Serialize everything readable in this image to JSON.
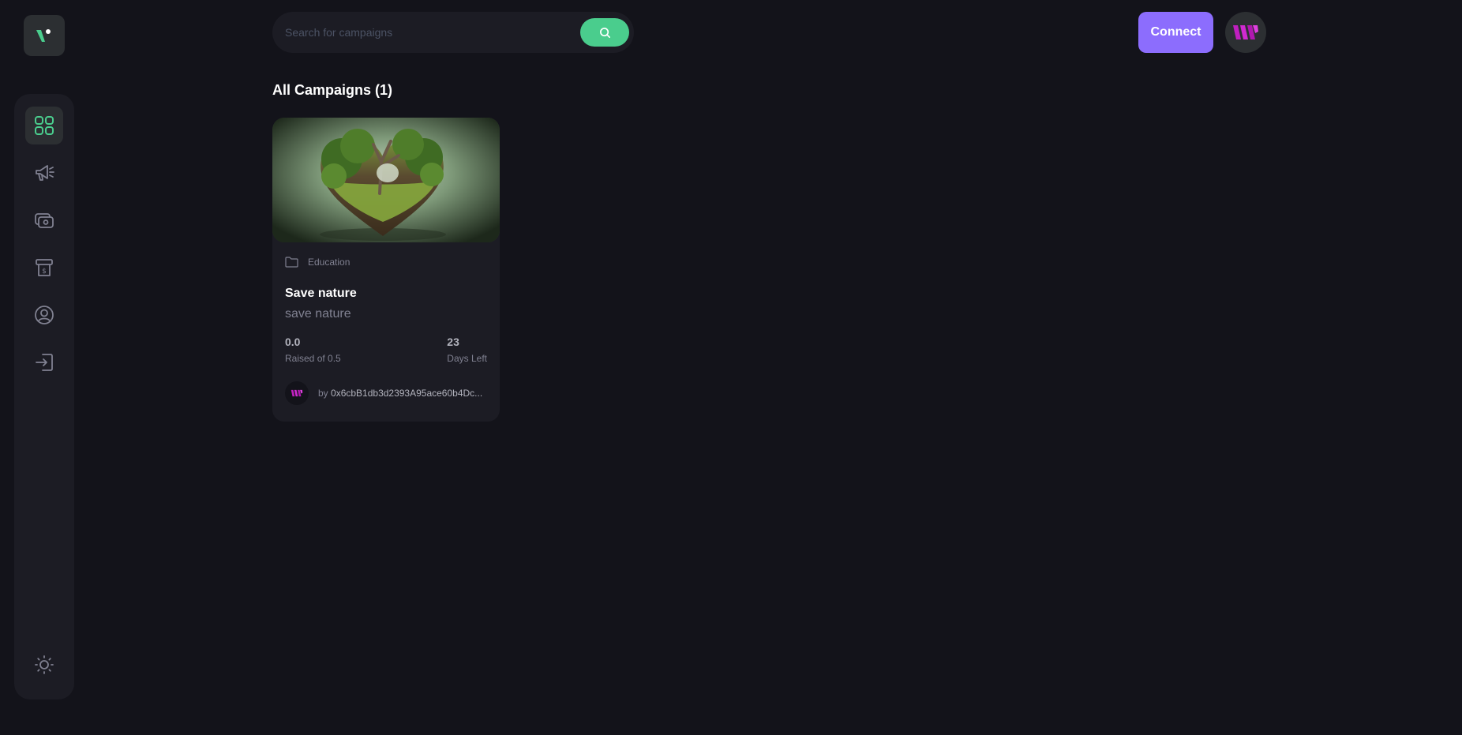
{
  "app": {
    "logo_icon": "brand-v-logo-icon"
  },
  "sidebar": {
    "items": [
      {
        "name": "dashboard",
        "icon": "dashboard-grid-icon",
        "active": true
      },
      {
        "name": "campaign",
        "icon": "megaphone-icon",
        "active": false
      },
      {
        "name": "payment",
        "icon": "payment-icon",
        "active": false
      },
      {
        "name": "withdraw",
        "icon": "withdraw-icon",
        "active": false
      },
      {
        "name": "profile",
        "icon": "user-profile-icon",
        "active": false
      },
      {
        "name": "logout",
        "icon": "logout-icon",
        "active": false
      }
    ],
    "theme_icon": "sun-icon"
  },
  "header": {
    "search": {
      "placeholder": "Search for campaigns",
      "value": ""
    },
    "connect_label": "Connect",
    "profile_icon": "user-logo-icon"
  },
  "main": {
    "title": "All Campaigns (1)",
    "campaigns": [
      {
        "image": "heart-tree-image",
        "category": "Education",
        "title": "Save nature",
        "description": "save nature",
        "amount_collected": "0.0",
        "raised_label": "Raised of 0.5",
        "days_left": "23",
        "days_left_label": "Days Left",
        "owner_prefix": "by ",
        "owner": "0x6cbB1db3d2393A95ace60b4Dc..."
      }
    ]
  },
  "colors": {
    "background": "#13131a",
    "panel": "#1c1c24",
    "active_item": "#2c2f32",
    "accent_green": "#4acd8d",
    "connect_purple": "#8c6dfd",
    "brand_magenta": "#c01fbf",
    "muted_text": "#808191",
    "secondary_text": "#b2b3bd"
  }
}
